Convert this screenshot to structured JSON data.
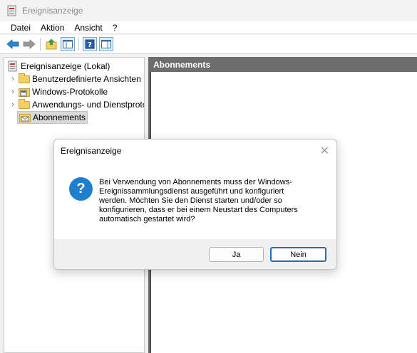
{
  "window": {
    "title": "Ereignisanzeige"
  },
  "menu": [
    "Datei",
    "Aktion",
    "Ansicht",
    "?"
  ],
  "tree": {
    "root": "Ereignisanzeige (Lokal)",
    "items": [
      {
        "label": "Benutzerdefinierte Ansichten",
        "expandable": true
      },
      {
        "label": "Windows-Protokolle",
        "expandable": true
      },
      {
        "label": "Anwendungs- und Dienstprotokolle",
        "expandable": true
      },
      {
        "label": "Abonnements",
        "expandable": false,
        "selected": true
      }
    ]
  },
  "right_pane": {
    "header": "Abonnements"
  },
  "dialog": {
    "title": "Ereignisanzeige",
    "message": "Bei Verwendung von Abonnements muss der Windows-Ereignissammlungsdienst ausgeführt und konfiguriert werden. Möchten Sie den Dienst starten und/oder so konfigurieren, dass er bei einem Neustart des Computers automatisch gestartet wird?",
    "icon": "question-icon",
    "yes_label": "Ja",
    "no_label": "Nein",
    "icon_glyph": "?"
  },
  "colors": {
    "accent": "#1f6fbf",
    "header_bg": "#6d6d6d",
    "question_blue": "#1e7fd0"
  }
}
